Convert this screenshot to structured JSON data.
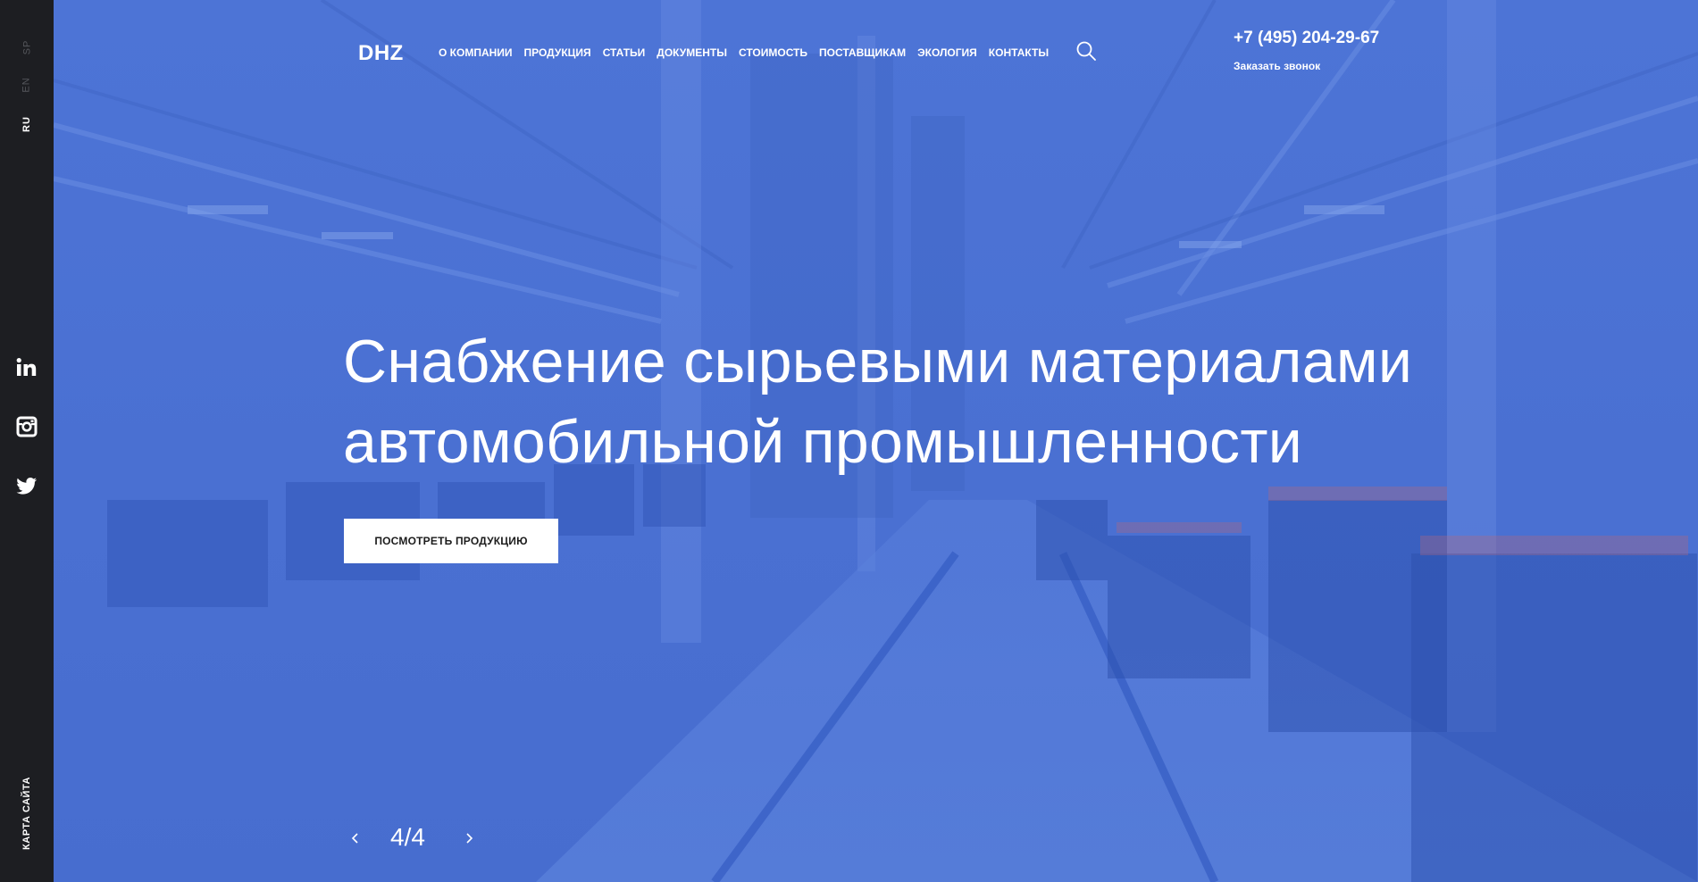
{
  "sidebar": {
    "languages": [
      {
        "label": "SP",
        "active": false
      },
      {
        "label": "EN",
        "active": false
      },
      {
        "label": "RU",
        "active": true
      }
    ],
    "social_icons": [
      "linkedin-icon",
      "instagram-icon",
      "twitter-icon"
    ],
    "sitemap_label": "КАРТА САЙТА"
  },
  "header": {
    "logo": "DHZ",
    "nav": [
      "О КОМПАНИИ",
      "ПРОДУКЦИЯ",
      "СТАТЬИ",
      "ДОКУМЕНТЫ",
      "СТОИМОСТЬ",
      "ПОСТАВЩИКАМ",
      "ЭКОЛОГИЯ",
      "КОНТАКТЫ"
    ],
    "search_icon": "search-icon",
    "phone": "+7 (495) 204-29-67",
    "callback": "Заказать звонок"
  },
  "hero": {
    "headline_line1": "Снабжение сырьевыми материалами",
    "headline_line2": "автомобильной промышленности",
    "cta_label": "ПОСМОТРЕТЬ ПРОДУКЦИЮ"
  },
  "slider": {
    "counter": "4/4"
  },
  "colors": {
    "rail": "#1d1e22",
    "hero_overlay": "#4a72d4",
    "text": "#ffffff"
  }
}
